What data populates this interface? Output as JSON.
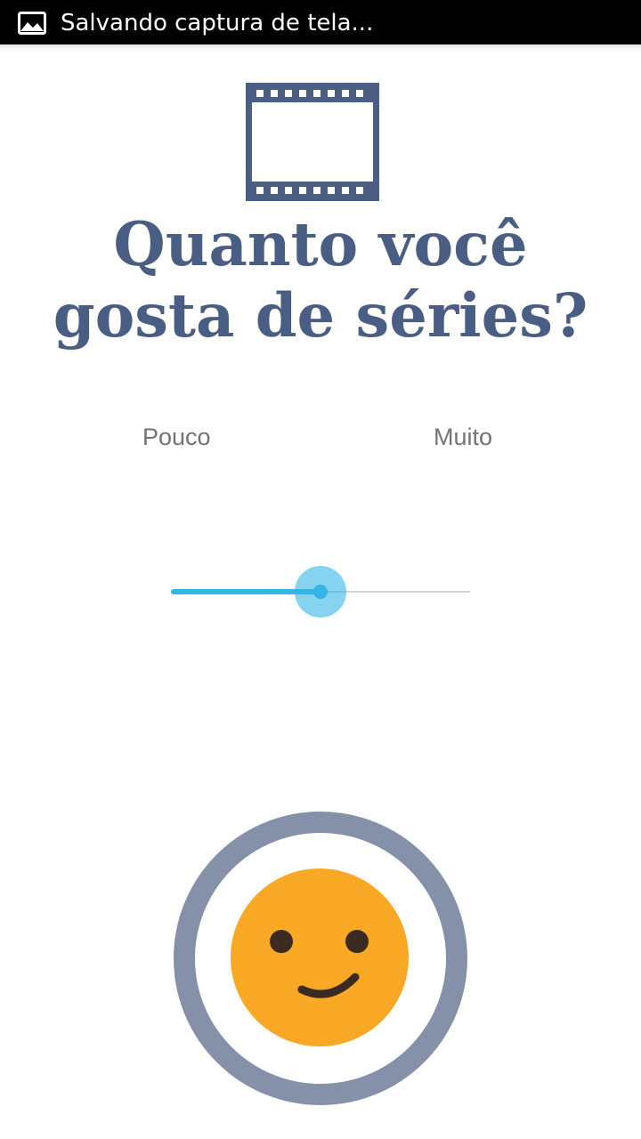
{
  "status_bar": {
    "icon": "image-notification-icon",
    "text": "Salvando captura de tela..."
  },
  "header": {
    "icon": "film-strip-icon",
    "title_line1": "Quanto você",
    "title_line2": "gosta de séries?",
    "title_color": "#4a5d82"
  },
  "rating": {
    "label_min": "Pouco",
    "label_max": "Muito",
    "slider_value_percent": 50,
    "slider_accent": "#33b5e5"
  },
  "feedback": {
    "icon": "smiley-face-icon",
    "ring_color": "#8591a8",
    "face_color": "#f9a825"
  }
}
